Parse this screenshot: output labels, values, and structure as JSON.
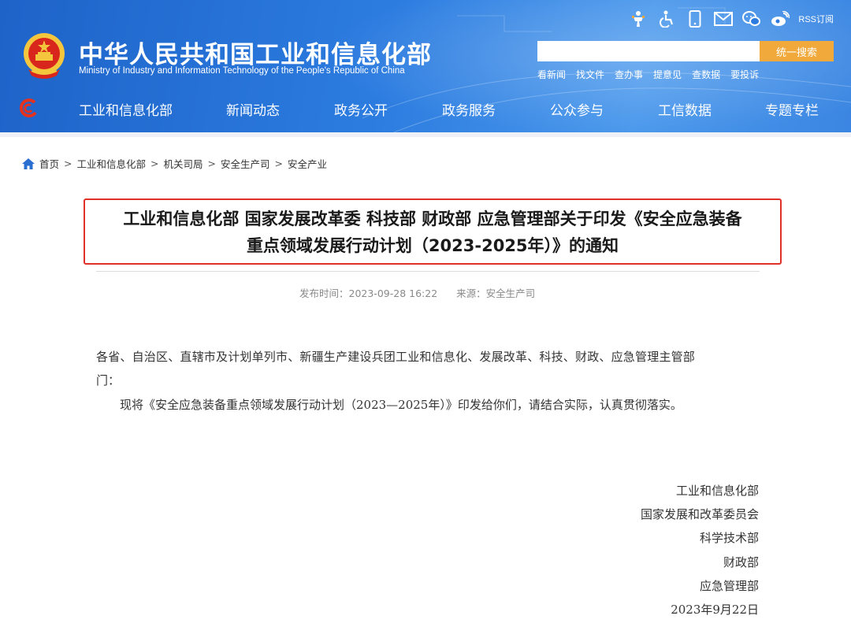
{
  "header": {
    "title": "中华人民共和国工业和信息化部",
    "subtitle": "Ministry of Industry and Information Technology of the People's Republic of China",
    "tools": [
      {
        "icon": "elder-mode-icon"
      },
      {
        "icon": "accessibility-icon"
      },
      {
        "icon": "mobile-icon"
      },
      {
        "icon": "mail-icon"
      },
      {
        "icon": "wechat-icon"
      },
      {
        "icon": "weibo-icon"
      }
    ],
    "rss_label": "RSS订阅",
    "search": {
      "placeholder": "",
      "button_label": "统一搜索"
    },
    "quick_links": [
      "看新闻",
      "找文件",
      "查办事",
      "提意见",
      "查数据",
      "要投诉"
    ],
    "nav": [
      "工业和信息化部",
      "新闻动态",
      "政务公开",
      "政务服务",
      "公众参与",
      "工信数据",
      "专题专栏"
    ]
  },
  "breadcrumb": [
    "首页",
    "工业和信息化部",
    "机关司局",
    "安全生产司",
    "安全产业"
  ],
  "article": {
    "title_line1": "工业和信息化部 国家发展改革委 科技部 财政部 应急管理部关于印发《安全应急装备",
    "title_line2": "重点领域发展行动计划（2023-2025年）》的通知",
    "publish_time": "发布时间：2023-09-28 16:22",
    "source": "来源：安全生产司",
    "salutation_line1": "各省、自治区、直辖市及计划单列市、新疆生产建设兵团工业和信息化、发展改革、科技、财政、应急管理主管部",
    "salutation_line2": "门：",
    "paragraph": "现将《安全应急装备重点领域发展行动计划（2023—2025年）》印发给你们，请结合实际，认真贯彻落实。",
    "signatories": [
      "工业和信息化部",
      "国家发展和改革委员会",
      "科学技术部",
      "财政部",
      "应急管理部"
    ],
    "date": "2023年9月22日"
  },
  "colors": {
    "header_blue": "#2c7ce0",
    "search_button": "#f2a93b",
    "title_border": "#e0302a"
  }
}
